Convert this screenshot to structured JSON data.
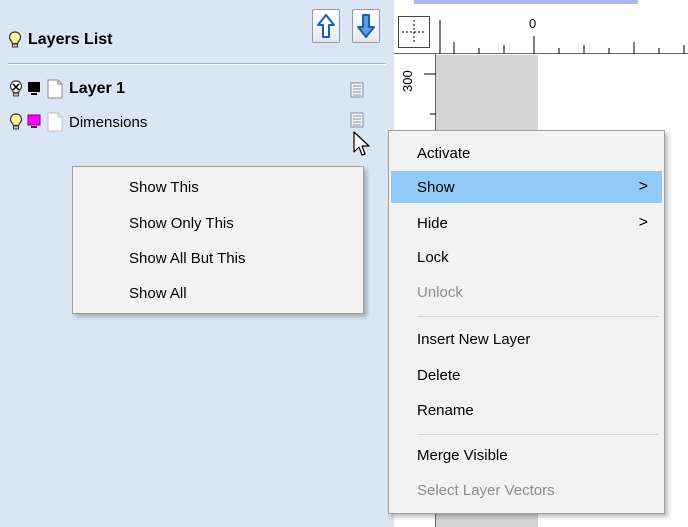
{
  "layers_panel": {
    "title": "Layers List",
    "icons": {
      "title_bulb": "lightbulb-icon",
      "move_up": "arrow-up-icon",
      "move_down": "arrow-down-icon"
    },
    "layers": [
      {
        "name": "Layer 1",
        "bold": true,
        "visibility_icon": "lightbulb-off-icon",
        "color": "#000000"
      },
      {
        "name": "Dimensions",
        "bold": false,
        "visibility_icon": "lightbulb-icon",
        "color": "#ff00ff"
      }
    ]
  },
  "ruler": {
    "top_label": "0",
    "left_label": "300"
  },
  "context_menu": {
    "items": [
      {
        "label": "Activate",
        "disabled": false,
        "submenu": false,
        "selected": false
      },
      {
        "label": "Show",
        "disabled": false,
        "submenu": true,
        "selected": true
      },
      {
        "label": "Hide",
        "disabled": false,
        "submenu": true,
        "selected": false
      },
      {
        "label": "Lock",
        "disabled": false,
        "submenu": false,
        "selected": false
      },
      {
        "label": "Unlock",
        "disabled": true,
        "submenu": false,
        "selected": false
      },
      {
        "label": "Insert New Layer",
        "disabled": false,
        "submenu": false,
        "selected": false
      },
      {
        "label": "Delete",
        "disabled": false,
        "submenu": false,
        "selected": false
      },
      {
        "label": "Rename",
        "disabled": false,
        "submenu": false,
        "selected": false
      },
      {
        "label": "Merge Visible",
        "disabled": false,
        "submenu": false,
        "selected": false
      },
      {
        "label": "Select Layer Vectors",
        "disabled": true,
        "submenu": false,
        "selected": false
      }
    ],
    "submenu_chevron": ">"
  },
  "show_submenu": {
    "items": [
      {
        "label": "Show This"
      },
      {
        "label": "Show Only This"
      },
      {
        "label": "Show All But This"
      },
      {
        "label": "Show All"
      }
    ]
  },
  "colors": {
    "panel_bg": "#dae6f4",
    "menu_bg": "#f2f2f2",
    "menu_highlight": "#91c9f7",
    "disabled_text": "#8d8d8d"
  }
}
